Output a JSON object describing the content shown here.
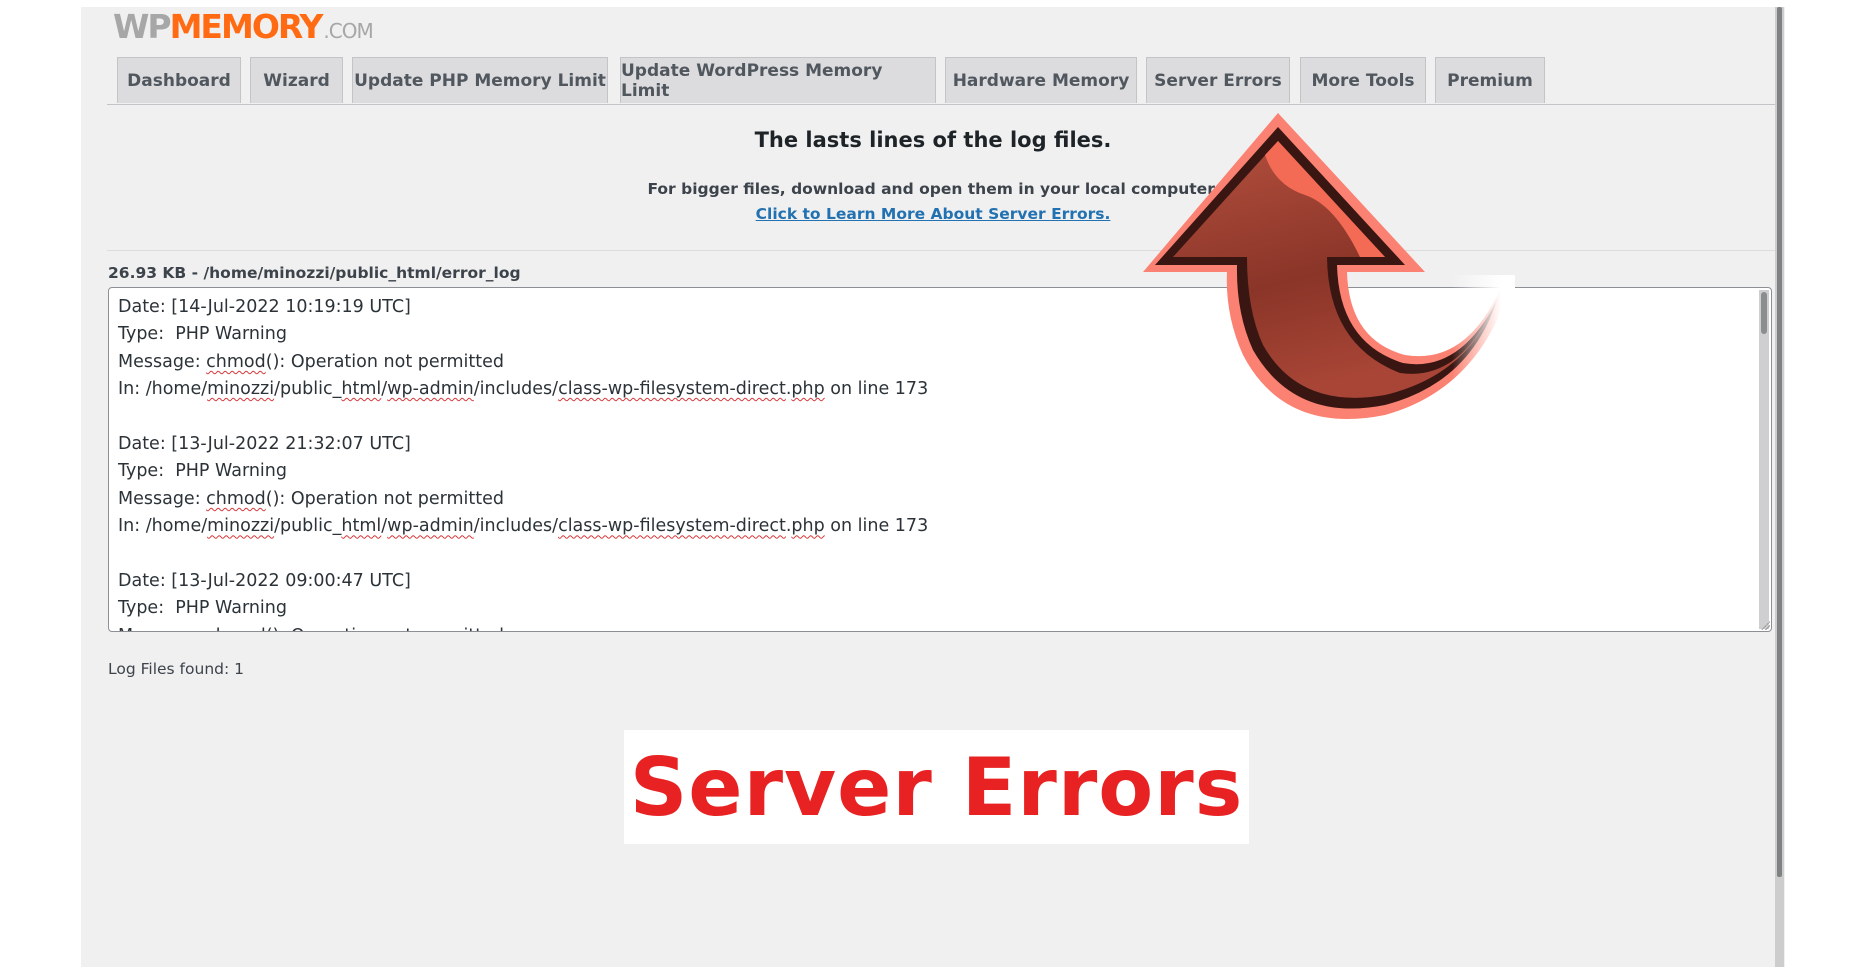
{
  "logo": {
    "wp": "WP",
    "memory": "MEMORY",
    "com": ".COM"
  },
  "tabs": [
    {
      "label": "Dashboard"
    },
    {
      "label": "Wizard"
    },
    {
      "label": "Update PHP Memory Limit"
    },
    {
      "label": "Update WordPress Memory Limit"
    },
    {
      "label": "Hardware Memory"
    },
    {
      "label": "Server Errors",
      "active": true
    },
    {
      "label": "More Tools"
    },
    {
      "label": "Premium"
    }
  ],
  "main": {
    "heading": "The lasts lines of the log files.",
    "subtext": "For bigger files, download and open them in your local computer.",
    "learn_more_link": "Click to Learn More About Server Errors.",
    "file_label": "26.93 KB - /home/minozzi/public_html/error_log",
    "log_entries": [
      {
        "date": "Date: [14-Jul-2022 10:19:19 UTC]",
        "type": "Type:  PHP Warning",
        "message": "chmod(): Operation not permitted",
        "file": "/home/minozzi/public_html/wp-admin/includes/class-wp-filesystem-direct.php",
        "line": "173"
      },
      {
        "date": "Date: [13-Jul-2022 21:32:07 UTC]",
        "type": "Type:  PHP Warning",
        "message": "chmod(): Operation not permitted",
        "file": "/home/minozzi/public_html/wp-admin/includes/class-wp-filesystem-direct.php",
        "line": "173"
      },
      {
        "date": "Date: [13-Jul-2022 09:00:47 UTC]",
        "type": "Type:  PHP Warning",
        "message": "chmod(): Operation not permitted",
        "file": "",
        "line": ""
      }
    ],
    "log_files_found": "Log Files found: 1"
  },
  "banner": {
    "text": "Server Errors",
    "color": "#e82222"
  },
  "icons": {
    "callout": "curved-up-arrow-icon"
  },
  "colors": {
    "brand_orange": "#ff6a13",
    "link": "#2271b1",
    "panel_bg": "#f0f0f1",
    "tab_bg": "#dcdcde"
  }
}
